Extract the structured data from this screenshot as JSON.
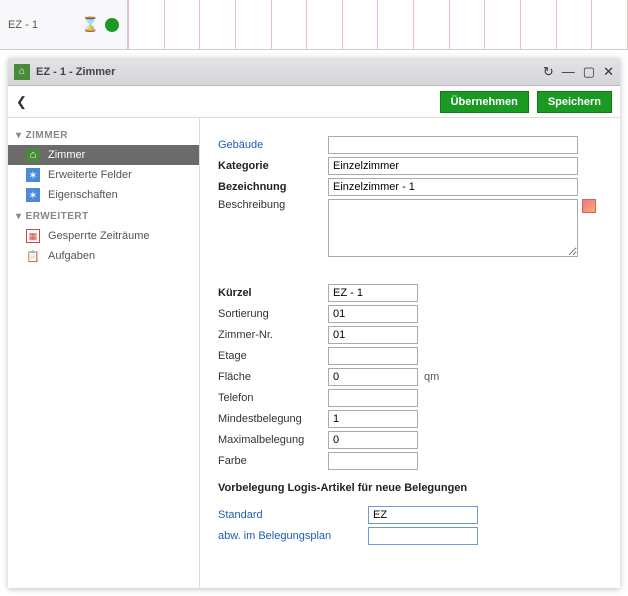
{
  "top_tab": {
    "label": "EZ - 1",
    "status_icon": "hourglass",
    "dot_color": "#1a9a22"
  },
  "window": {
    "title": "EZ - 1 - Zimmer",
    "actions": {
      "apply": "Übernehmen",
      "save": "Speichern"
    }
  },
  "sidebar": {
    "section1": {
      "title": "ZIMMER",
      "items": [
        {
          "icon": "house",
          "label": "Zimmer",
          "active": true
        },
        {
          "icon": "fields",
          "label": "Erweiterte Felder"
        },
        {
          "icon": "props",
          "label": "Eigenschaften"
        }
      ]
    },
    "section2": {
      "title": "ERWEITERT",
      "items": [
        {
          "icon": "calendar",
          "label": "Gesperrte Zeiträume"
        },
        {
          "icon": "clipboard",
          "label": "Aufgaben"
        }
      ]
    }
  },
  "form": {
    "gebaeude_label": "Gebäude",
    "gebaeude": "",
    "kategorie_label": "Kategorie",
    "kategorie": "Einzelzimmer",
    "bezeichnung_label": "Bezeichnung",
    "bezeichnung": "Einzelzimmer - 1",
    "beschreibung_label": "Beschreibung",
    "beschreibung": "",
    "kuerzel_label": "Kürzel",
    "kuerzel": "EZ - 1",
    "sortierung_label": "Sortierung",
    "sortierung": "01",
    "zimmernr_label": "Zimmer-Nr.",
    "zimmernr": "01",
    "etage_label": "Etage",
    "etage": "",
    "flaeche_label": "Fläche",
    "flaeche": "0",
    "flaeche_unit": "qm",
    "telefon_label": "Telefon",
    "telefon": "",
    "mindest_label": "Mindestbelegung",
    "mindest": "1",
    "maximal_label": "Maximalbelegung",
    "maximal": "0",
    "farbe_label": "Farbe",
    "farbe": "",
    "vorbelegung_title": "Vorbelegung Logis-Artikel für neue Belegungen",
    "standard_label": "Standard",
    "standard": "EZ",
    "abw_label": "abw. im Belegungsplan",
    "abw": ""
  }
}
